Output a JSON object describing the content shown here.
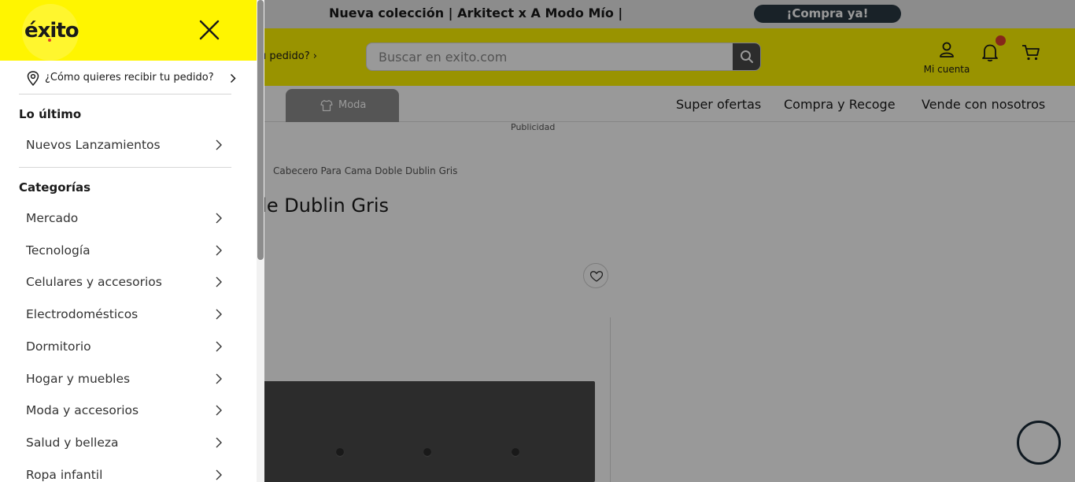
{
  "promo": {
    "text": "Nueva colección | Arkitect x A Modo Mío |",
    "cta": "¡Compra ya!"
  },
  "header": {
    "deliver_partial": "ibir tu pedido?",
    "search_placeholder": "Buscar en exito.com",
    "account_label": "Mi cuenta"
  },
  "nav": {
    "active_category": "Moda",
    "links": [
      "Super ofertas",
      "Compra y Recoge",
      "Vende con nosotros"
    ]
  },
  "ad_label": "Publicidad",
  "product": {
    "breadcrumb": "Cabecero Para Cama Doble Dublin Gris",
    "title_partial": "ble Dublin Gris"
  },
  "drawer": {
    "logo": "éxito",
    "location": "¿Cómo quieres recibir tu pedido?",
    "latest_title": "Lo último",
    "latest_items": [
      "Nuevos Lanzamientos"
    ],
    "categories_title": "Categorías",
    "categories": [
      "Mercado",
      "Tecnología",
      "Celulares y accesorios",
      "Electrodomésticos",
      "Dormitorio",
      "Hogar y muebles",
      "Moda y accesorios",
      "Salud y belleza",
      "Ropa infantil"
    ]
  },
  "colors": {
    "brand_yellow": "#fff500",
    "promo_button": "#2b3a44",
    "notification_dot": "#e0412a",
    "overlay": "rgba(0,0,0,0.40)"
  }
}
